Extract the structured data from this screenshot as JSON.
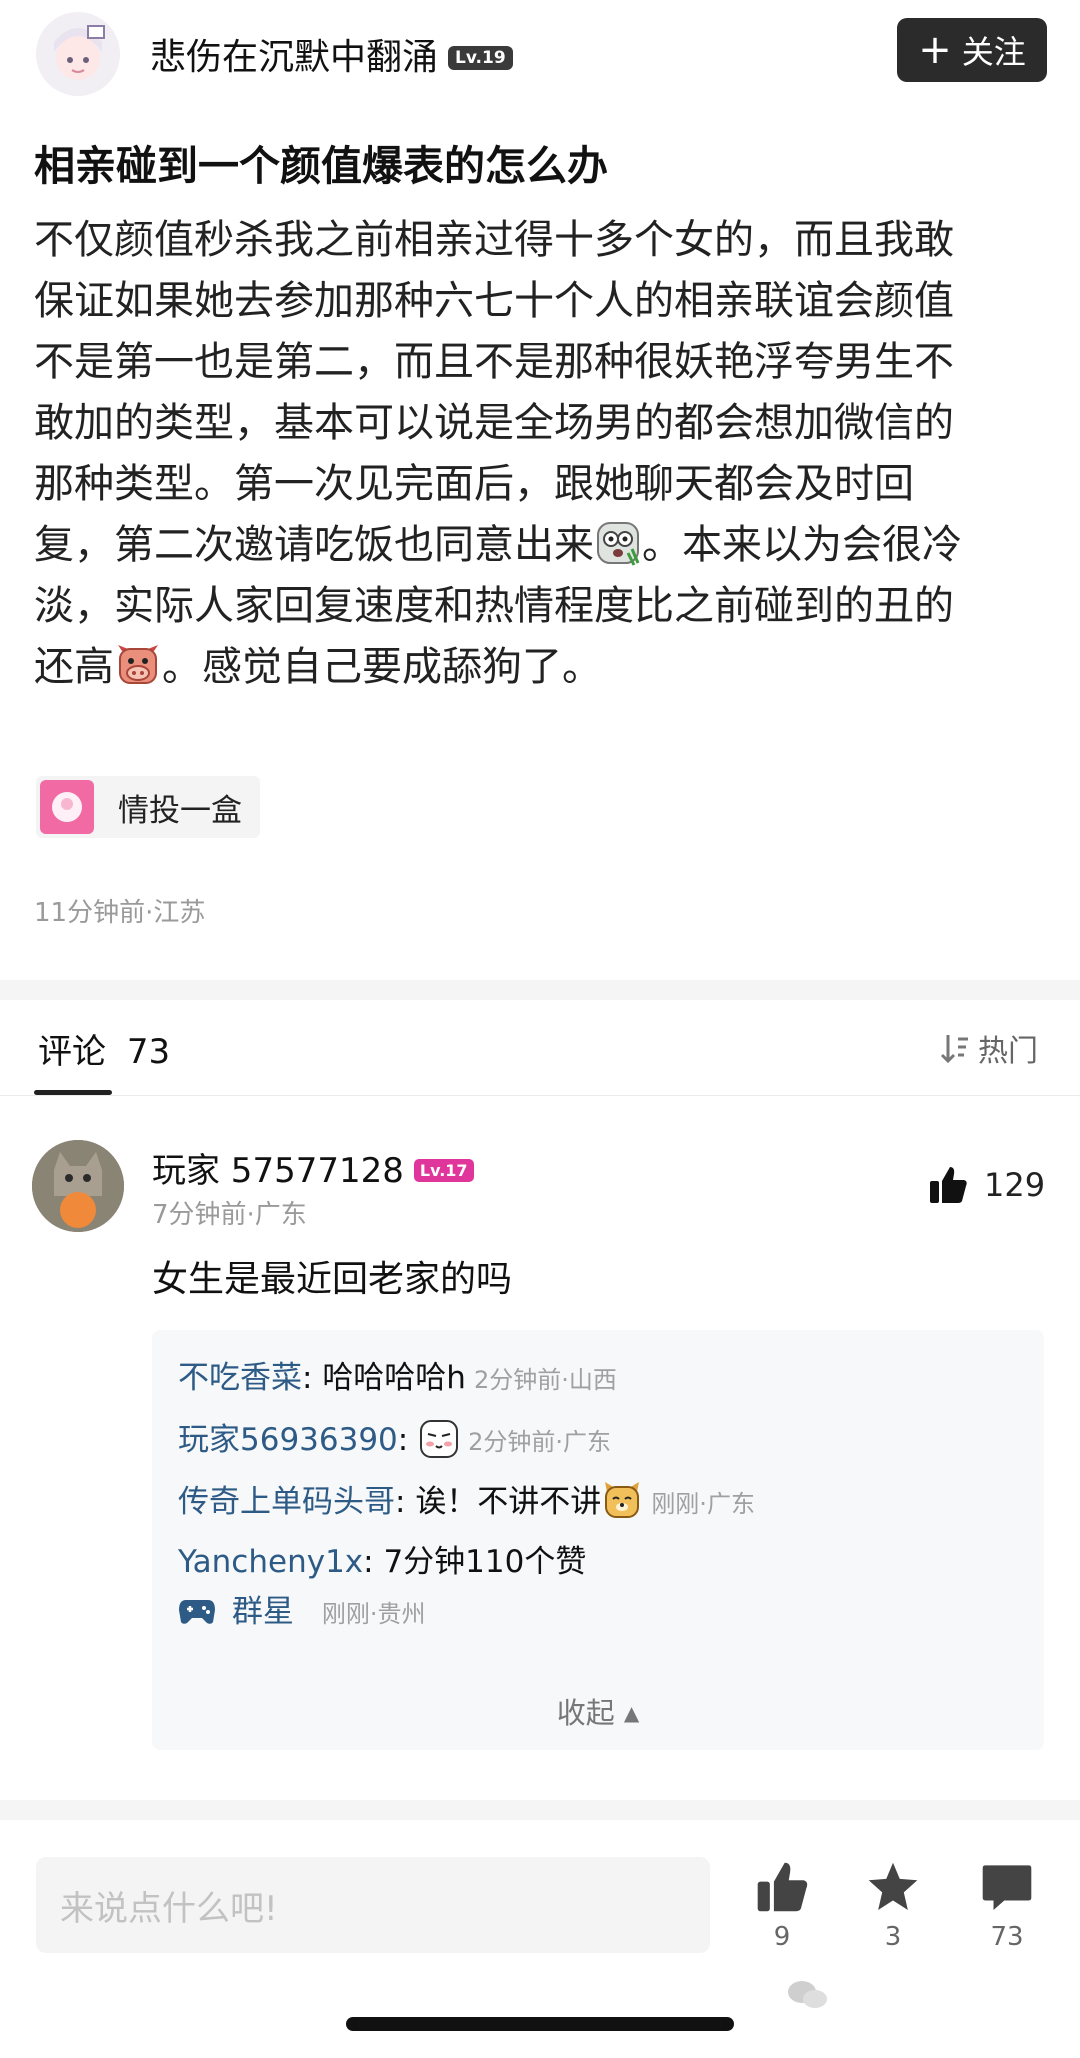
{
  "header": {
    "author": "悲伤在沉默中翻涌",
    "level": "Lv.19",
    "follow_label": "关注"
  },
  "post": {
    "title": "相亲碰到一个颜值爆表的怎么办",
    "lines": [
      "不仅颜值秒杀我之前相亲过得十多个女的，而且我敢",
      "保证如果她去参加那种六七十个人的相亲联谊会颜值",
      "不是第一也是第二，而且不是那种很妖艳浮夸男生不",
      "敢加的类型，基本可以说是全场男的都会想加微信的",
      "那种类型。第一次见完面后，跟她聊天都会及时回",
      "复，第二次邀请吃饭也同意出来",
      "。本来以为会很冷",
      "淡，实际人家回复速度和热情程度比之前碰到的丑的",
      "还高",
      "。感觉自己要成舔狗了。"
    ],
    "topic": "情投一盒",
    "meta": "11分钟前·江苏"
  },
  "comments_header": {
    "tab_label": "评论",
    "count": "73",
    "sort_label": "热门"
  },
  "comment": {
    "user": "玩家 57577128",
    "level": "Lv.17",
    "meta": "7分钟前·广东",
    "likes": "129",
    "text": "女生是最近回老家的吗",
    "replies": [
      {
        "name": "不吃香菜",
        "sep": ": ",
        "text": "哈哈哈哈h",
        "time": "2分钟前·山西"
      },
      {
        "name": "玩家56936390",
        "sep": ": ",
        "text": "",
        "time": "2分钟前·广东"
      },
      {
        "name": "传奇上单码头哥",
        "sep": ": ",
        "text": "诶！不讲不讲",
        "time": "刚刚·广东"
      },
      {
        "name": "Yancheny1x",
        "sep": ": ",
        "text": "7分钟110个赞",
        "time": ""
      },
      {
        "name": "群星",
        "sep": "",
        "text": "",
        "time": "刚刚·贵州"
      }
    ],
    "collapse_label": "收起"
  },
  "bottom": {
    "input_placeholder": "来说点什么吧!",
    "like_count": "9",
    "fav_count": "3",
    "comment_count": "73"
  }
}
